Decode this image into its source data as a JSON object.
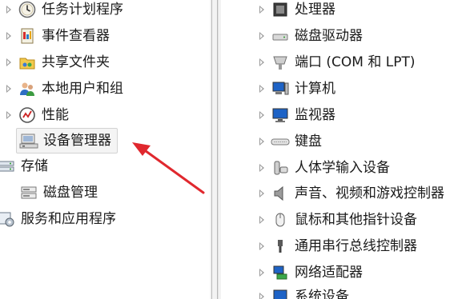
{
  "left_tree": {
    "items": [
      {
        "label": "任务计划程序",
        "icon": "task-scheduler-clock-icon"
      },
      {
        "label": "事件查看器",
        "icon": "event-viewer-icon"
      },
      {
        "label": "共享文件夹",
        "icon": "shared-folders-icon"
      },
      {
        "label": "本地用户和组",
        "icon": "local-users-groups-icon"
      },
      {
        "label": "性能",
        "icon": "performance-icon"
      },
      {
        "label": "设备管理器",
        "icon": "device-manager-icon",
        "selected": true
      },
      {
        "label": "存储",
        "icon": "storage-icon"
      },
      {
        "label": "磁盘管理",
        "icon": "disk-management-icon"
      },
      {
        "label": "服务和应用程序",
        "icon": "services-applications-icon"
      }
    ]
  },
  "device_tree": {
    "items": [
      {
        "label": "处理器",
        "icon": "processor-icon"
      },
      {
        "label": "磁盘驱动器",
        "icon": "disk-drive-icon"
      },
      {
        "label": "端口 (COM 和 LPT)",
        "icon": "port-icon"
      },
      {
        "label": "计算机",
        "icon": "computer-icon"
      },
      {
        "label": "监视器",
        "icon": "monitor-icon"
      },
      {
        "label": "键盘",
        "icon": "keyboard-icon"
      },
      {
        "label": "人体学输入设备",
        "icon": "hid-icon"
      },
      {
        "label": "声音、视频和游戏控制器",
        "icon": "sound-icon"
      },
      {
        "label": "鼠标和其他指针设备",
        "icon": "mouse-icon"
      },
      {
        "label": "通用串行总线控制器",
        "icon": "usb-icon"
      },
      {
        "label": "网络适配器",
        "icon": "network-adapter-icon"
      },
      {
        "label": "系统设备",
        "icon": "system-devices-icon"
      }
    ]
  },
  "annotation": {
    "color": "#e0282e",
    "points_to": "设备管理器"
  }
}
